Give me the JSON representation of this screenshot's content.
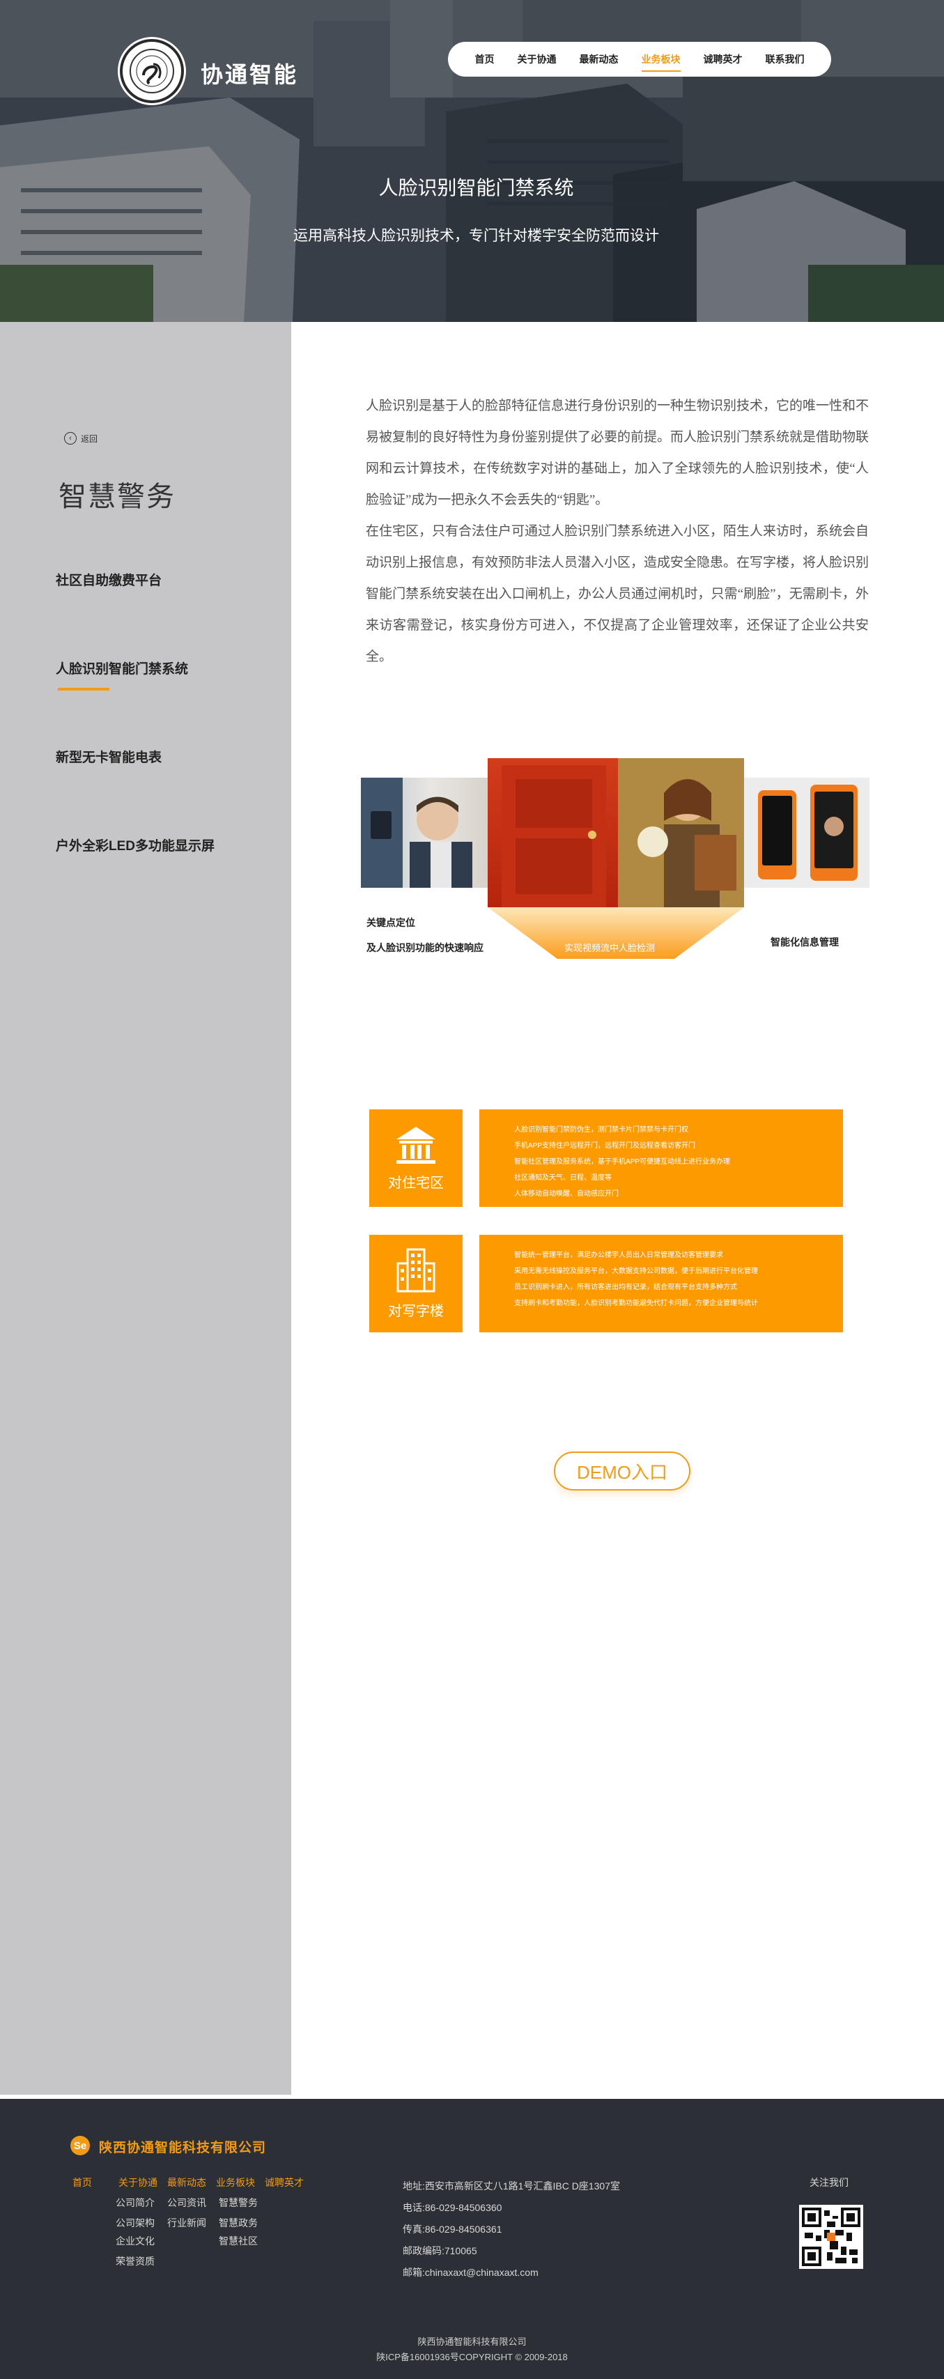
{
  "brand": {
    "name": "协通智能"
  },
  "nav": {
    "items": [
      {
        "label": "首页",
        "active": false
      },
      {
        "label": "关于协通",
        "active": false
      },
      {
        "label": "最新动态",
        "active": false
      },
      {
        "label": "业务板块",
        "active": true
      },
      {
        "label": "诚聘英才",
        "active": false
      },
      {
        "label": "联系我们",
        "active": false
      }
    ]
  },
  "hero": {
    "title": "人脸识别智能门禁系统",
    "subtitle": "运用高科技人脸识别技术，专门针对楼宇安全防范而设计"
  },
  "sidebar": {
    "back_label": "返回",
    "title": "智慧警务",
    "items": [
      {
        "label": "社区自助缴费平台",
        "active": false
      },
      {
        "label": "人脸识别智能门禁系统",
        "active": true
      },
      {
        "label": "新型无卡智能电表",
        "active": false
      },
      {
        "label": "户外全彩LED多功能显示屏",
        "active": false
      }
    ]
  },
  "intro": {
    "p1": "人脸识别是基于人的脸部特征信息进行身份识别的一种生物识别技术，它的唯一性和不易被复制的良好特性为身份鉴别提供了必要的前提。而人脸识别门禁系统就是借助物联网和云计算技术，在传统数字对讲的基础上，加入了全球领先的人脸识别技术，使“人脸验证”成为一把永久不会丢失的“钥匙”。",
    "p2": "在住宅区，只有合法住户可通过人脸识别门禁系统进入小区，陌生人来访时，系统会自动识别上报信息，有效预防非法人员潜入小区，造成安全隐患。在写字楼，将人脸识别智能门禁系统安装在出入口闸机上，办公人员通过闸机时，只需“刷脸”，无需刷卡，外来访客需登记，核实身份方可进入，不仅提高了企业管理效率，还保证了企业公共安全。"
  },
  "collage": {
    "caption_left_1": "关键点定位",
    "caption_left_2": "及人脸识别功能的快速响应",
    "caption_center": "实现视频流中人脸检测",
    "caption_right": "智能化信息管理"
  },
  "cards": [
    {
      "label": "对住宅区",
      "icon": "residence-building-icon",
      "lines": [
        "人脸识别智能门禁防伪生，测门禁卡片门禁禁与卡开门权",
        "手机APP支持住户远程开门，远程开门及远程查看访客开门",
        "智能社区管理及服务系统，基于手机APP可便捷互动线上进行业务办理",
        "社区通知及天气、日程、温度等",
        "人体移动自动唤醒、自动感应开门"
      ]
    },
    {
      "label": "对写字楼",
      "icon": "office-tower-icon",
      "lines": [
        "智能统一管理平台，满足办公楼宇人员出入日常管理及访客管理要求",
        "采用无需无线操控及服务平台，大数据支持公司数据，便于后期进行平台化管理",
        "员工识别刷卡进入，所有访客进出均有记录，结合现有平台支持多种方式",
        "支持刷卡和考勤功能，人脸识别考勤功能避免代打卡问题，方便企业管理与统计"
      ]
    }
  ],
  "demo_label": "DEMO入口",
  "footer": {
    "company": "陕西协通智能科技有限公司",
    "nav": [
      "首页",
      "关于协通",
      "最新动态",
      "业务板块",
      "诚聘英才"
    ],
    "col1": [
      "公司简介",
      "公司架构",
      "企业文化",
      "荣誉资质"
    ],
    "col2": [
      "公司资讯",
      "行业新闻"
    ],
    "col3": [
      "智慧警务",
      "智慧政务",
      "智慧社区"
    ],
    "address": "地址:西安市高新区丈八1路1号汇鑫IBC D座1307室",
    "phone": "电话:86-029-84506360",
    "fax": "传真:86-029-84506361",
    "zip": "邮政编码:710065",
    "email": "邮箱:chinaxaxt@chinaxaxt.com",
    "follow": "关注我们",
    "copy_1": "陕西协通智能科技有限公司",
    "copy_2": "陕ICP备16001936号COPYRIGHT © 2009-2018"
  },
  "colors": {
    "accent": "#f29b16",
    "card": "#fd9a00",
    "sidebar": "#c6c5c8",
    "footer": "#2c2f35"
  }
}
